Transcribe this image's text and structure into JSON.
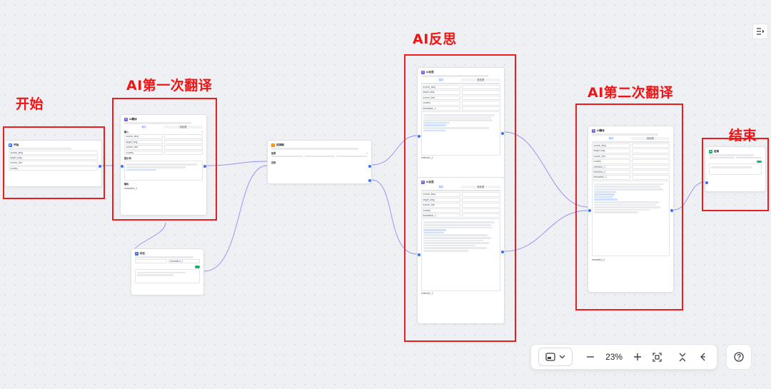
{
  "annotations": {
    "start": "开始",
    "first_translate": "AI第一次翻译",
    "reflect": "AI反思",
    "second_translate": "AI第二次翻译",
    "end": "结束"
  },
  "toolbar": {
    "zoom": "23%"
  },
  "icons": {
    "minimap": "minimap-icon",
    "dropdown": "chevron-down-icon",
    "zoom_out": "minus-icon",
    "zoom_in": "plus-icon",
    "fit": "fit-view-icon",
    "collapse": "collapse-icon",
    "back": "chevron-left-icon",
    "help": "help-icon",
    "log": "run-log-icon"
  },
  "colors": {
    "annotation": "#ee1c1c",
    "wire": "#8d8ff5",
    "accent": "#3370ff",
    "success": "#18b36b"
  },
  "nodes": {
    "start": {
      "title": "开始",
      "inputs": [
        "source_lang",
        "target_lang",
        "source_text",
        "country"
      ]
    },
    "ai1": {
      "title": "AI翻译",
      "tabs": [
        "单次",
        "批处理"
      ],
      "input_label": "输入",
      "prompt_label": "提示词",
      "output_label": "输出",
      "output_var": "translation_1",
      "inputs": [
        "source_lang",
        "target_lang",
        "source_text",
        "country"
      ]
    },
    "cond": {
      "title": "选择器",
      "if_label": "如果",
      "else_label": "否则"
    },
    "aux": {
      "title": "优化",
      "output_var": "translation_1"
    },
    "reflect1": {
      "title": "AI反思",
      "output_var": "reflection_1",
      "inputs": [
        "source_lang",
        "target_lang",
        "source_text",
        "country",
        "translation_1"
      ]
    },
    "reflect2": {
      "title": "AI反思",
      "output_var": "reflection_2",
      "inputs": [
        "source_lang",
        "target_lang",
        "source_text",
        "country",
        "translation_1"
      ]
    },
    "ai2": {
      "title": "AI翻译",
      "output_var": "translation_2",
      "inputs": [
        "source_lang",
        "target_lang",
        "source_text",
        "country",
        "reflection_1",
        "reflection_2",
        "translation_1"
      ]
    },
    "end": {
      "title": "结束"
    }
  }
}
